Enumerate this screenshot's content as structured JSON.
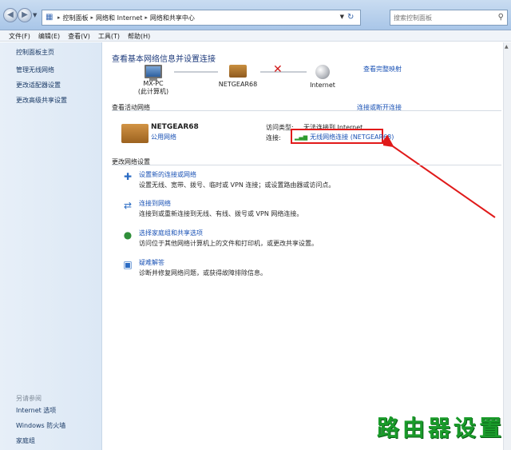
{
  "address": {
    "crumbs": [
      "控制面板",
      "网络和 Internet",
      "网络和共享中心"
    ],
    "search_placeholder": "搜索控制面板"
  },
  "menubar": [
    "文件(F)",
    "编辑(E)",
    "查看(V)",
    "工具(T)",
    "帮助(H)"
  ],
  "sidebar": {
    "home": "控制面板主页",
    "items": [
      {
        "label": "管理无线网络"
      },
      {
        "label": "更改适配器设置"
      },
      {
        "label": "更改高级共享设置"
      }
    ],
    "see_also": "另请参阅",
    "bottom": [
      {
        "label": "Internet 选项"
      },
      {
        "label": "Windows 防火墙"
      },
      {
        "label": "家庭组"
      }
    ]
  },
  "main": {
    "title": "查看基本网络信息并设置连接",
    "full_map": "查看完整映射",
    "nodes": [
      {
        "name": "MX-PC",
        "sub": "(此计算机)"
      },
      {
        "name": "NETGEAR68",
        "sub": ""
      },
      {
        "name": "Internet",
        "sub": ""
      }
    ],
    "active_header": "查看活动网络",
    "connect_link": "连接或断开连接",
    "network": {
      "name": "NETGEAR68",
      "type": "公用网络",
      "access_label": "访问类型:",
      "access_value": "无法连接到 Internet",
      "conn_label": "连接:",
      "conn_value": "无线网络连接 (NETGEAR68)"
    },
    "change_header": "更改网络设置",
    "tasks": [
      {
        "title": "设置新的连接或网络",
        "desc": "设置无线、宽带、拨号、临时或 VPN 连接；或设置路由器或访问点。"
      },
      {
        "title": "连接到网络",
        "desc": "连接到或重新连接到无线、有线、拨号或 VPN 网络连接。"
      },
      {
        "title": "选择家庭组和共享选项",
        "desc": "访问位于其他网络计算机上的文件和打印机，或更改共享设置。"
      },
      {
        "title": "疑难解答",
        "desc": "诊断并修复网络问题，或获得故障排除信息。"
      }
    ]
  },
  "watermark": "路由器设置",
  "colors": {
    "link": "#1a52b5",
    "highlight_box": "#e21a1a",
    "watermark": "#1a9b2a"
  }
}
